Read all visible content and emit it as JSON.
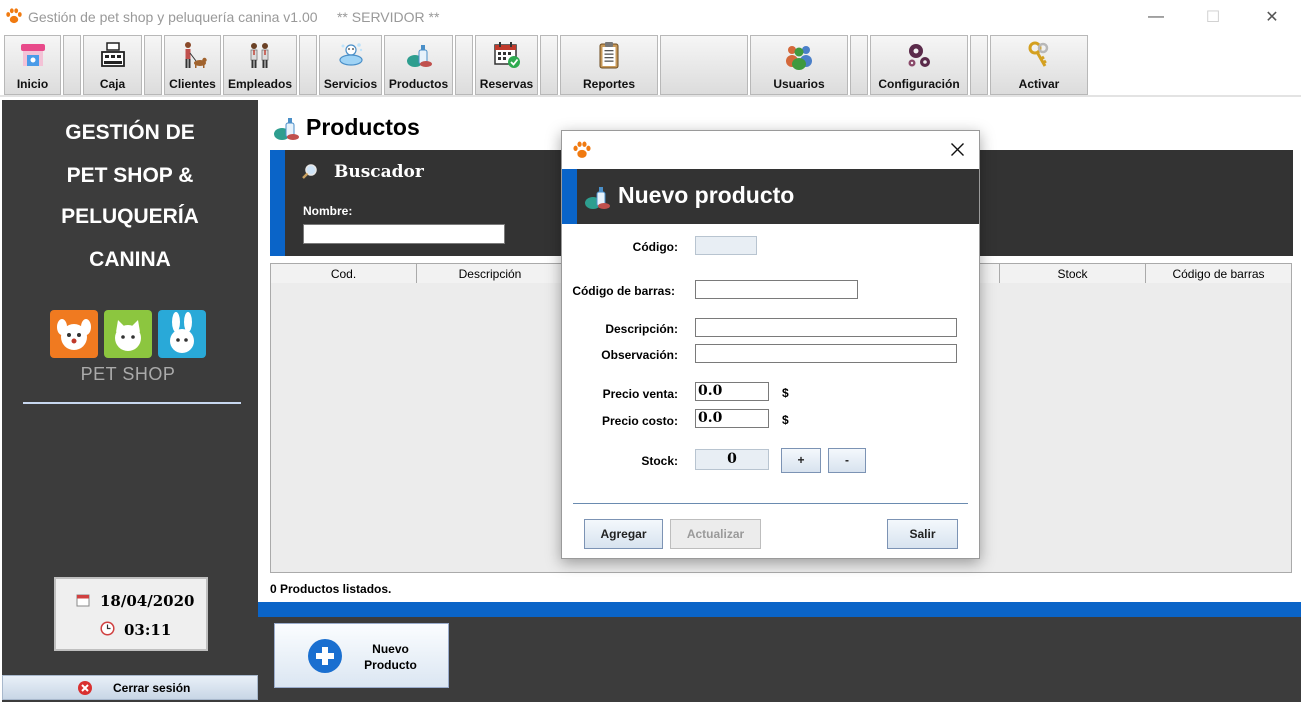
{
  "window": {
    "title": "Gestión de pet shop y peluquería canina v1.00     ** SERVIDOR **",
    "controls": {
      "minimize": "—",
      "maximize": "☐",
      "close": "✕"
    }
  },
  "toolbar": {
    "items": [
      {
        "label": "Inicio",
        "icon": "shop-icon"
      },
      {
        "label": "Caja",
        "icon": "cash-register-icon"
      },
      {
        "label": "Clientes",
        "icon": "person-dog-icon"
      },
      {
        "label": "Empleados",
        "icon": "employees-icon"
      },
      {
        "label": "Servicios",
        "icon": "dog-bath-icon"
      },
      {
        "label": "Productos",
        "icon": "products-icon"
      },
      {
        "label": "Reservas",
        "icon": "calendar-check-icon"
      },
      {
        "label": "Reportes",
        "icon": "clipboard-icon"
      },
      {
        "label": "Usuarios",
        "icon": "users-icon"
      },
      {
        "label": "Configuración",
        "icon": "gears-icon"
      },
      {
        "label": "Activar",
        "icon": "keys-icon"
      }
    ]
  },
  "sidebar": {
    "title_lines": [
      "GESTIÓN DE",
      "PET SHOP &",
      "PELUQUERÍA",
      "CANINA"
    ],
    "logo_text": "PET SHOP",
    "date": "18/04/2020",
    "time": "03:11",
    "logout_label": "Cerrar sesión"
  },
  "main": {
    "title": "Productos",
    "search": {
      "heading": "Buscador",
      "name_label": "Nombre:",
      "name_value": ""
    },
    "table": {
      "columns": [
        "Cod.",
        "Descripción",
        "",
        "",
        "",
        "Stock",
        "Código de barras"
      ]
    },
    "status": "0 Productos listados.",
    "new_button_line1": "Nuevo",
    "new_button_line2": "Producto"
  },
  "dialog": {
    "title": "Nuevo producto",
    "fields": {
      "codigo_label": "Código:",
      "codigo_value": "",
      "barras_label": "Código de barras:",
      "barras_value": "",
      "descripcion_label": "Descripción:",
      "descripcion_value": "",
      "observacion_label": "Observación:",
      "observacion_value": "",
      "precio_venta_label": "Precio venta:",
      "precio_venta_value": "0.0",
      "precio_costo_label": "Precio costo:",
      "precio_costo_value": "0.0",
      "currency": "$",
      "stock_label": "Stock:",
      "stock_value": "0",
      "plus": "+",
      "minus": "-"
    },
    "buttons": {
      "agregar": "Agregar",
      "actualizar": "Actualizar",
      "salir": "Salir"
    }
  },
  "colors": {
    "accent_blue": "#0a64c8",
    "dark_panel": "#3c3c3c",
    "paw_orange": "#f07a10"
  }
}
